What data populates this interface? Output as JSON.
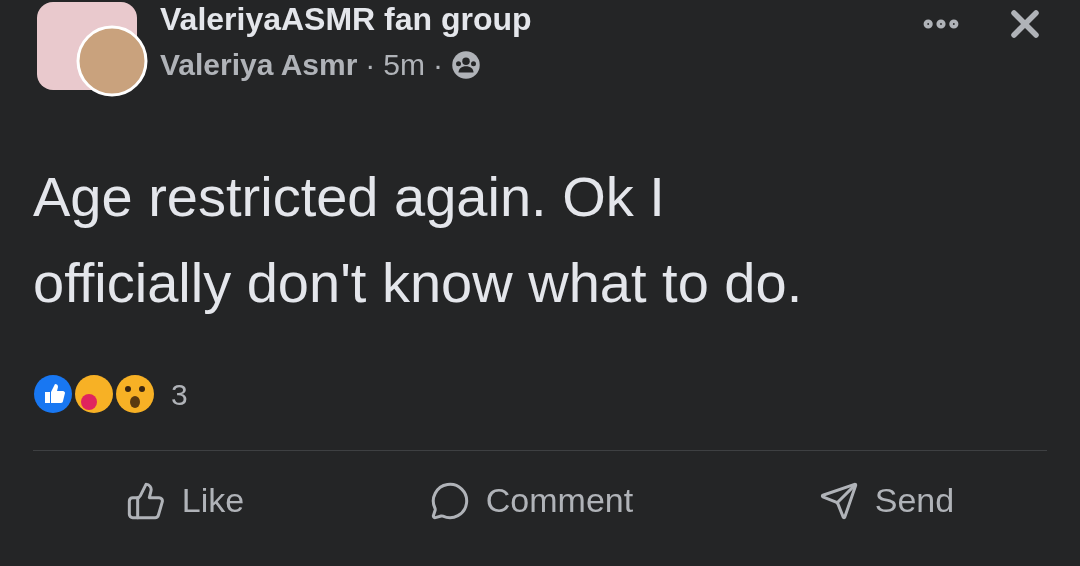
{
  "post": {
    "group_name": "ValeriyaASMR fan group",
    "author": "Valeriya Asmr",
    "separator_1": "·",
    "time": "5m",
    "separator_2": "·",
    "text": "Age restricted again. Ok I officially don't know what to do."
  },
  "reactions": {
    "count": "3"
  },
  "actions": [
    {
      "kind": "like",
      "label": "Like"
    },
    {
      "kind": "comment",
      "label": "Comment"
    },
    {
      "kind": "send",
      "label": "Send"
    }
  ]
}
